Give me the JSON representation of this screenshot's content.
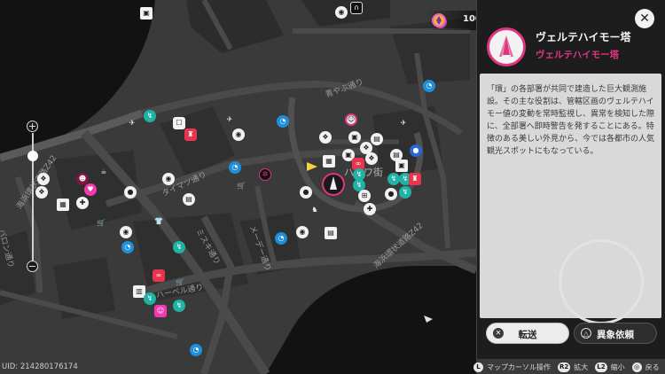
{
  "map": {
    "street_labels": [
      "海浜環状道路Z42",
      "バロン通り",
      "タイマツ通り",
      "ミスキ通り",
      "メーデー通り",
      "青やぶ通り",
      "ハニワ街",
      "ハーベル通り",
      "海浜環状道路Z42"
    ]
  },
  "currency": {
    "value": "100",
    "icon": "gem-icon"
  },
  "panel": {
    "title": "ヴェルテハイモー塔",
    "subtitle": "ヴェルテハイモー塔",
    "description": "「環」の各部署が共同で建造した巨大観測施設。その主な役割は、管轄区画のヴェルテハイモー値の変動を常時監視し、異常を検知した際に、全部署へ即時警告を発することにある。特徴のある美しい外見から、今では各都市の人気観光スポットにもなっている。",
    "accent_color": "#e0357f",
    "buttons": {
      "transfer": "転送",
      "request": "異象依頼"
    }
  },
  "zoom": {
    "plus": "+",
    "minus": "−",
    "level": 0.82
  },
  "uid": "UID: 214280176174",
  "controls": [
    {
      "key": "L",
      "label": "マップカーソル操作"
    },
    {
      "key": "R2",
      "label": "拡大"
    },
    {
      "key": "L2",
      "label": "縮小"
    },
    {
      "key": "◎",
      "label": "戻る"
    }
  ]
}
